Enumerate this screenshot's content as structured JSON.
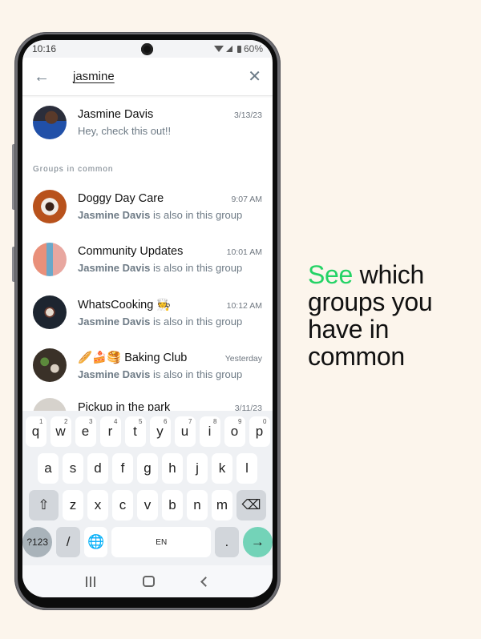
{
  "status_bar": {
    "time": "10:16",
    "battery": "60%"
  },
  "search": {
    "query": "jasmine"
  },
  "contact": {
    "name": "Jasmine Davis",
    "date": "3/13/23",
    "preview": "Hey, check this out!!"
  },
  "section_label": "Groups in common",
  "groups": [
    {
      "name": "Doggy Day Care",
      "time": "9:07 AM",
      "member": "Jasmine Davis",
      "suffix": " is also in this group"
    },
    {
      "name": "Community Updates",
      "time": "10:01 AM",
      "member": "Jasmine Davis",
      "suffix": " is also in this group"
    },
    {
      "name": "WhatsCooking 🧑‍🍳",
      "time": "10:12 AM",
      "member": "Jasmine Davis",
      "suffix": " is also in this group"
    },
    {
      "name": "🥖🍰🥞 Baking Club",
      "time": "Yesterday",
      "member": "Jasmine Davis",
      "suffix": " is also in this group"
    },
    {
      "name": "Pickup in the park",
      "time": "3/11/23"
    }
  ],
  "keyboard": {
    "row1": [
      "q",
      "w",
      "e",
      "r",
      "t",
      "y",
      "u",
      "i",
      "o",
      "p"
    ],
    "row1_hints": [
      "1",
      "2",
      "3",
      "4",
      "5",
      "6",
      "7",
      "8",
      "9",
      "0"
    ],
    "row2": [
      "a",
      "s",
      "d",
      "f",
      "g",
      "h",
      "j",
      "k",
      "l"
    ],
    "row3": [
      "z",
      "x",
      "c",
      "v",
      "b",
      "n",
      "m"
    ],
    "symbols_label": "?123",
    "slash": "/",
    "space_label": "EN",
    "period": "."
  },
  "tagline": {
    "accent": "See",
    "rest": " which groups you have in common",
    "accent_color": "#25d366"
  }
}
